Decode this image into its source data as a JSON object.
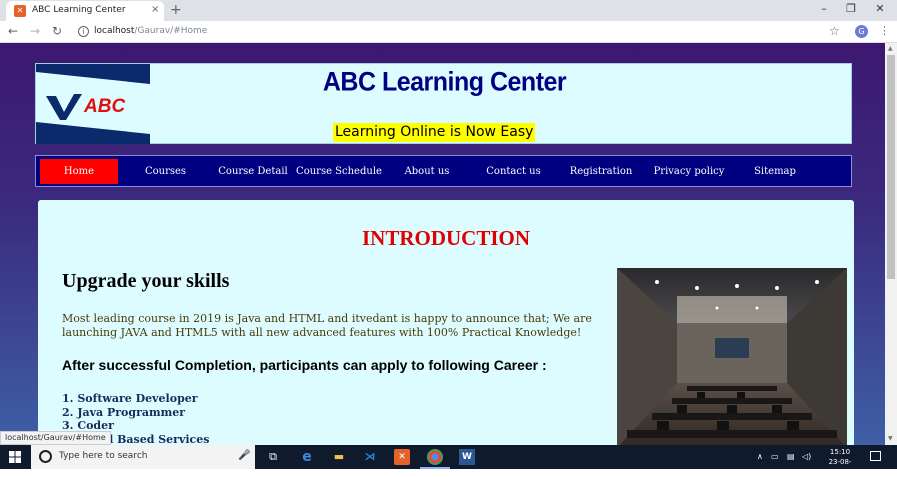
{
  "browser": {
    "tab_title": "ABC Learning Center",
    "tab_close": "×",
    "new_tab": "+",
    "url_host": "localhost",
    "url_path": "/Gaurav/#Home",
    "profile_initial": "G",
    "status_url": "localhost/Gaurav/#Home"
  },
  "site": {
    "title": "ABC Learning Center",
    "tagline": "Learning Online is Now Easy",
    "logo_text": "ABC"
  },
  "nav": {
    "items": [
      {
        "label": "Home",
        "active": true
      },
      {
        "label": "Courses"
      },
      {
        "label": "Course Detail"
      },
      {
        "label": "Course Schedule"
      },
      {
        "label": "About us"
      },
      {
        "label": "Contact us"
      },
      {
        "label": "Registration"
      },
      {
        "label": "Privacy policy"
      },
      {
        "label": "Sitemap"
      }
    ]
  },
  "content": {
    "heading": "INTRODUCTION",
    "subheading": "Upgrade your skills",
    "paragraph": "Most leading course in 2019 is Java and HTML and itvedant is happy to announce that; We are launching JAVA and HTML5 with all new advanced features with 100% Practical Knowledge!",
    "career_heading": "After successful Completion, participants can apply to following Career :",
    "careers": [
      "1. Software Developer",
      "2. Java Programmer",
      "3. Coder",
      "4. Cloud Based Services"
    ]
  },
  "taskbar": {
    "search_placeholder": "Type here to search",
    "time": "15:10",
    "date": "23-08-2019"
  },
  "colors": {
    "header_bg": "#ddfcff",
    "title": "#000080",
    "nav_bg": "#000080",
    "nav_active": "#ff0000",
    "intro": "#e00000",
    "tagline_bg": "#ffff00"
  }
}
